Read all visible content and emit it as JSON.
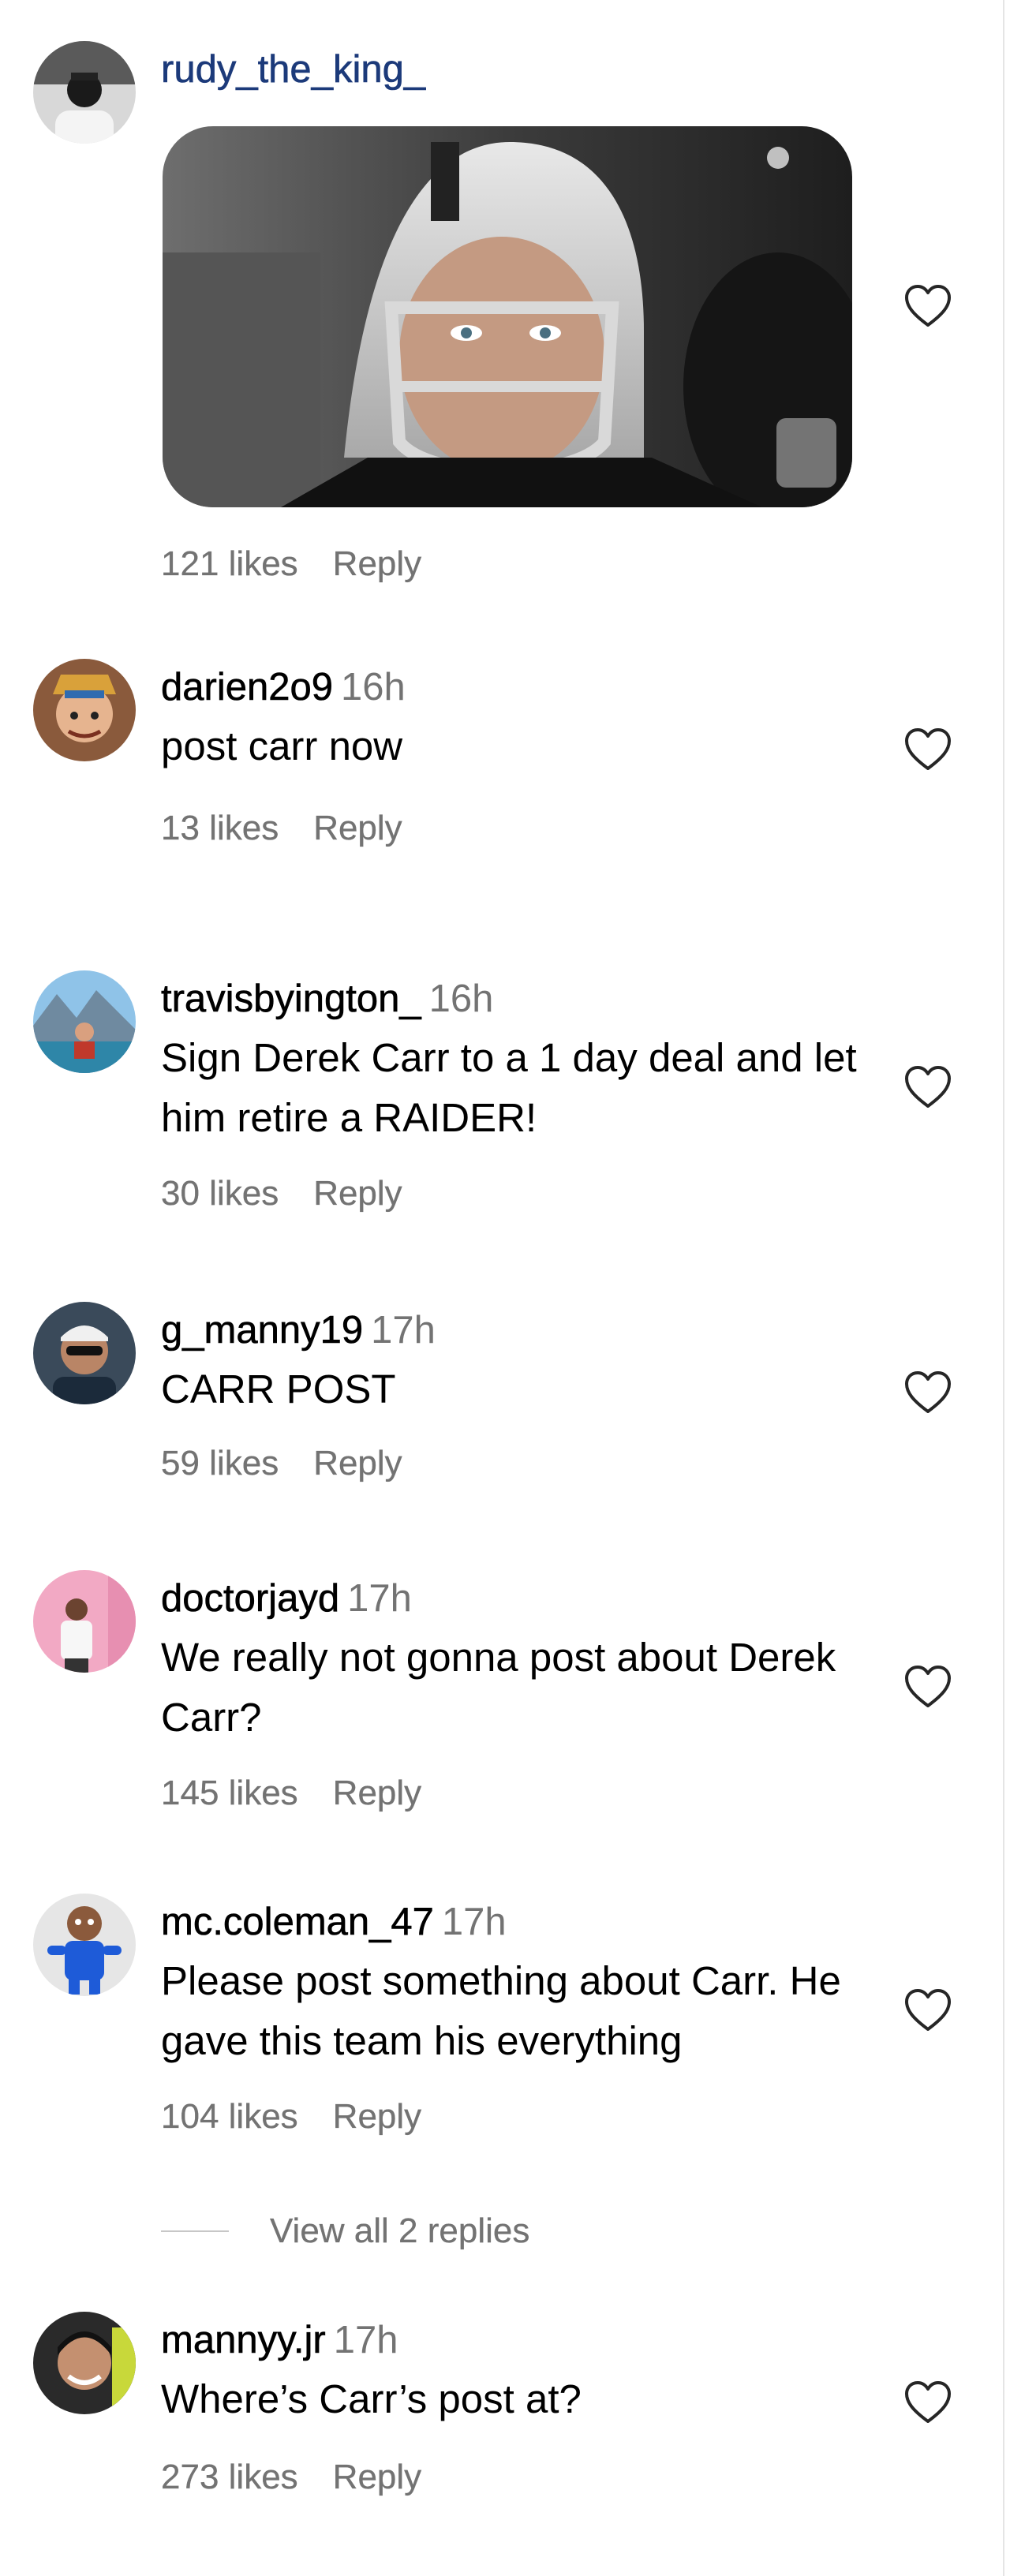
{
  "colors": {
    "username_link": "#1c3a7a",
    "muted": "#737373",
    "text": "#000000",
    "background": "#ffffff"
  },
  "comments": [
    {
      "username": "rudy_the_king_",
      "has_gif": true,
      "likes": "121 likes",
      "reply": "Reply",
      "heart_icon": "heart-outline-icon"
    },
    {
      "username": "darien2o9",
      "time": "16h",
      "text": "post carr now",
      "likes": "13 likes",
      "reply": "Reply",
      "heart_icon": "heart-outline-icon"
    },
    {
      "username": "travisbyington_",
      "time": "16h",
      "text": "Sign Derek Carr to a 1 day deal and let him retire a RAIDER!",
      "likes": "30 likes",
      "reply": "Reply",
      "heart_icon": "heart-outline-icon"
    },
    {
      "username": "g_manny19",
      "time": "17h",
      "text": "CARR POST",
      "likes": "59 likes",
      "reply": "Reply",
      "heart_icon": "heart-outline-icon"
    },
    {
      "username": "doctorjayd",
      "time": "17h",
      "text": "We really not gonna post about Derek Carr?",
      "likes": "145 likes",
      "reply": "Reply",
      "heart_icon": "heart-outline-icon"
    },
    {
      "username": "mc.coleman_47",
      "time": "17h",
      "text": "Please post something about Carr. He gave this team his everything",
      "likes": "104 likes",
      "reply": "Reply",
      "heart_icon": "heart-outline-icon"
    },
    {
      "username": "mannyy.jr",
      "time": "17h",
      "text": "Where’s Carr’s post at?",
      "likes": "273 likes",
      "reply": "Reply",
      "heart_icon": "heart-outline-icon"
    }
  ],
  "view_replies": "View all 2 replies"
}
